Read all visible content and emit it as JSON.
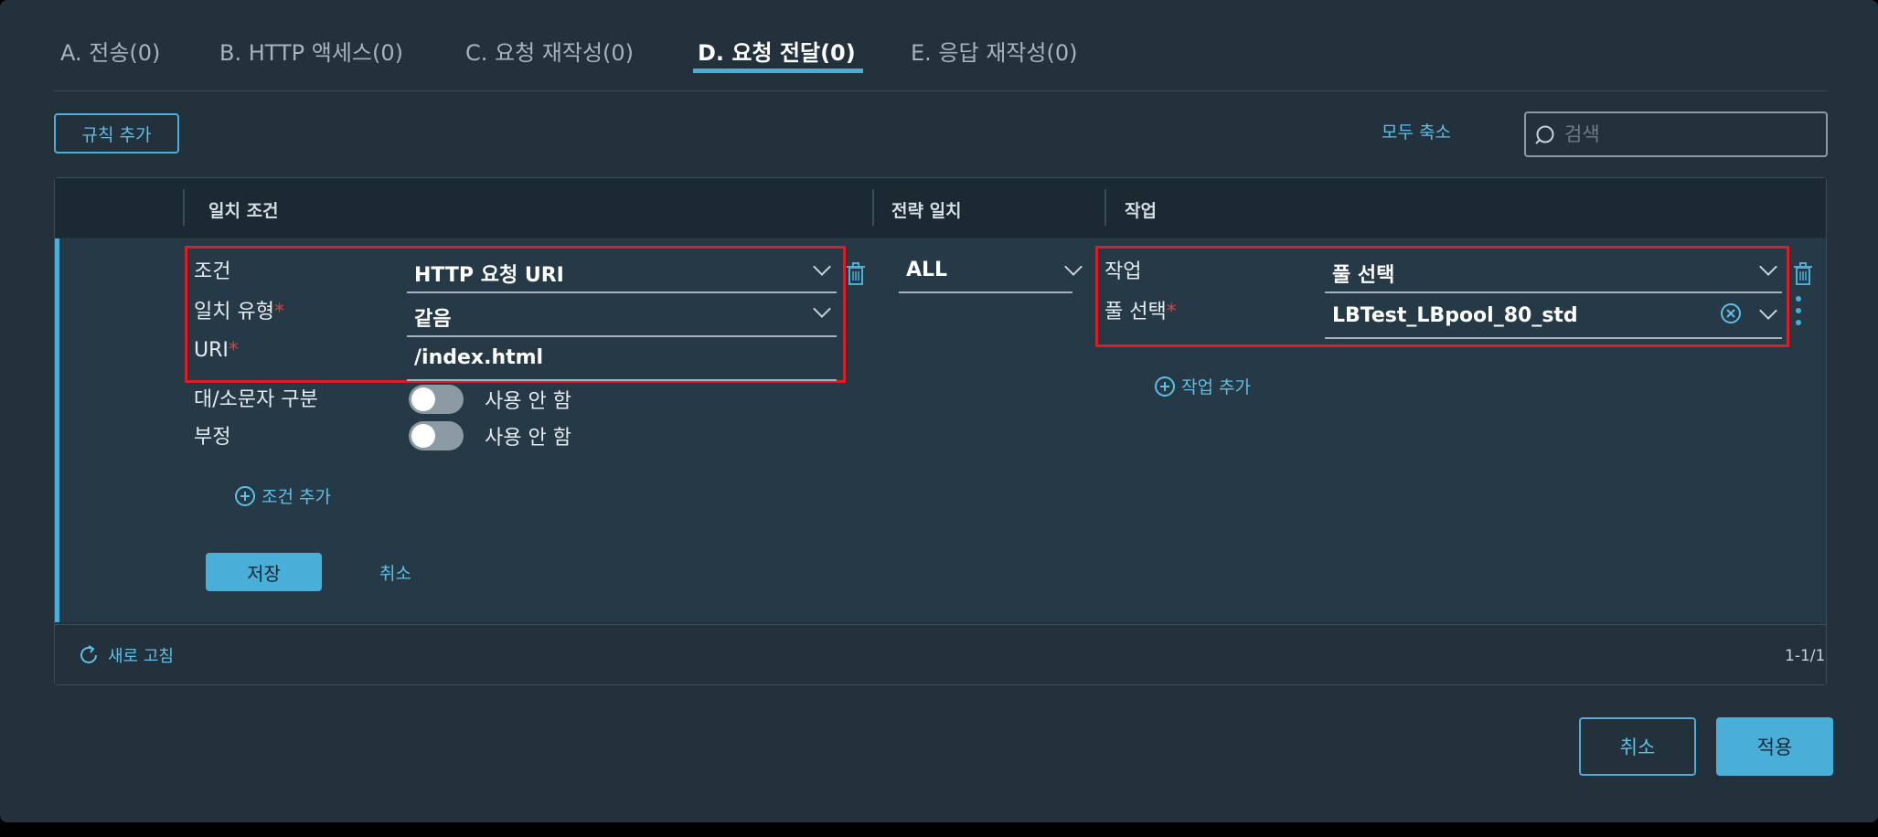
{
  "tabs": [
    {
      "label": "A. 전송(0)"
    },
    {
      "label": "B. HTTP 액세스(0)"
    },
    {
      "label": "C. 요청 재작성(0)"
    },
    {
      "label": "D. 요청 전달(0)"
    },
    {
      "label": "E. 응답 재작성(0)"
    }
  ],
  "active_tab": "D. 요청 전달(0)",
  "toolbar": {
    "add_rule": "규칙 추가",
    "collapse_all": "모두 축소",
    "search_placeholder": "검색"
  },
  "grid": {
    "columns": [
      "일치 조건",
      "전략 일치",
      "작업"
    ],
    "row": {
      "match": {
        "condition_label": "조건",
        "condition_value": "HTTP 요청 URI",
        "match_type_label": "일치 유형",
        "match_type_value": "같음",
        "uri_label": "URI",
        "uri_value": "/index.html",
        "case_label": "대/소문자 구분",
        "case_state": "사용 안 함",
        "negate_label": "부정",
        "negate_state": "사용 안 함",
        "add_condition": "조건 추가",
        "save": "저장",
        "cancel": "취소"
      },
      "strategy": {
        "value": "ALL"
      },
      "action": {
        "action_label": "작업",
        "action_value": "풀 선택",
        "pool_label": "풀 선택",
        "pool_value": "LBTest_LBpool_80_std",
        "add_action": "작업 추가"
      }
    },
    "footer": {
      "refresh": "새로 고침",
      "pagination": "1-1/1"
    }
  },
  "dialog_buttons": {
    "cancel": "취소",
    "apply": "적용"
  },
  "colors": {
    "accent": "#49afd9",
    "highlight": "#e01d24",
    "required": "#e0403a",
    "background": "#22313b"
  }
}
